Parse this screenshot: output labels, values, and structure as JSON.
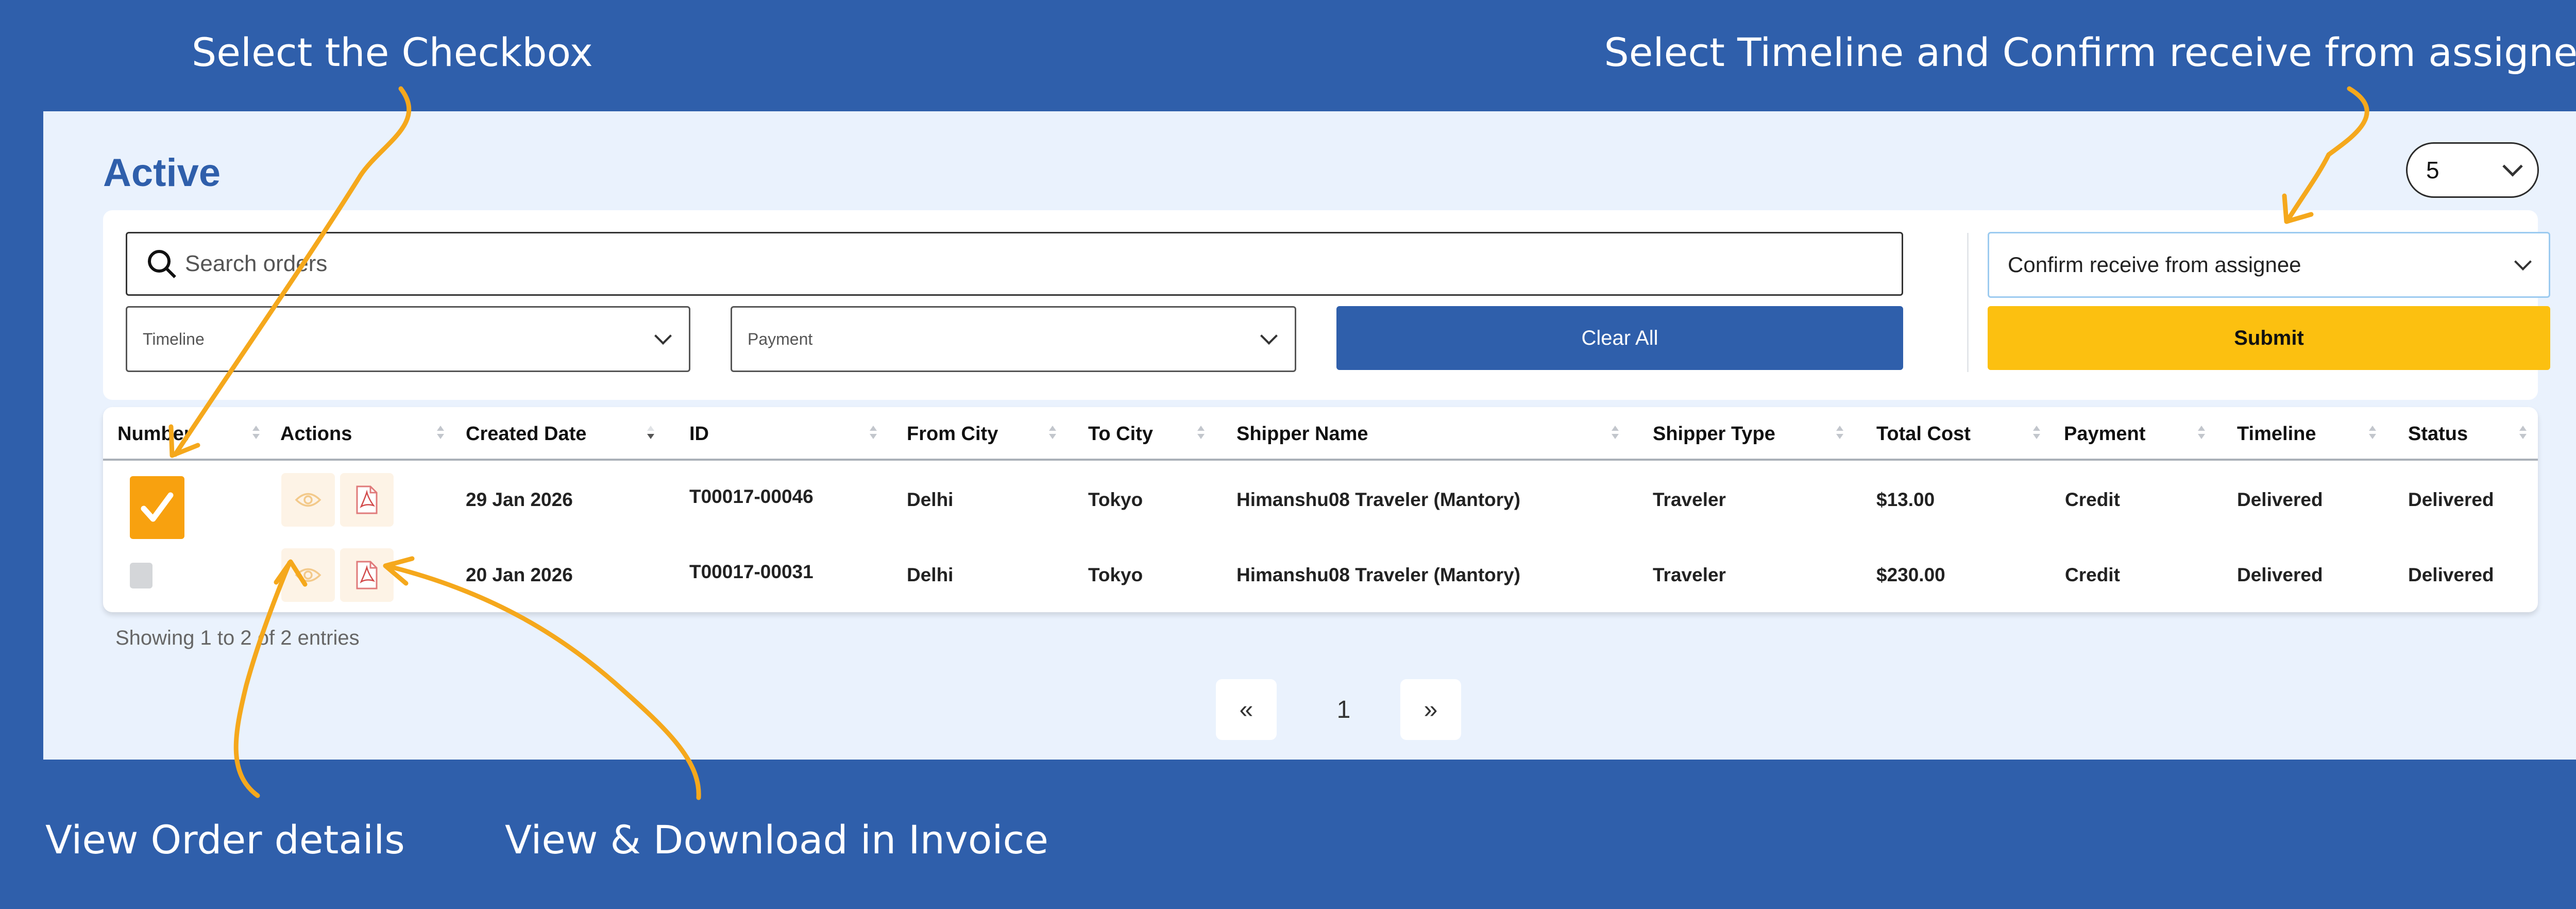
{
  "callouts": {
    "checkbox": "Select the Checkbox",
    "timeline": "Select Timeline and Confirm receive from assignee",
    "view_details": "View Order details",
    "invoice": "View & Download in Invoice"
  },
  "section_title": "Active",
  "page_size": "5",
  "filters": {
    "search_placeholder": "Search orders",
    "timeline_placeholder": "Timeline",
    "payment_placeholder": "Payment",
    "clear_all": "Clear All",
    "action_selected": "Confirm receive from assignee",
    "submit": "Submit"
  },
  "table": {
    "headers": [
      "Number",
      "Actions",
      "Created Date",
      "ID",
      "From City",
      "To City",
      "Shipper Name",
      "Shipper Type",
      "Total Cost",
      "Payment",
      "Timeline",
      "Status"
    ],
    "rows": [
      {
        "checked": true,
        "created": "29 Jan 2026",
        "id": "T00017-00046",
        "from": "Delhi",
        "to": "Tokyo",
        "shipper": "Himanshu08 Traveler (Mantory)",
        "shipper_type": "Traveler",
        "cost": "$13.00",
        "payment": "Credit",
        "timeline": "Delivered",
        "status": "Delivered"
      },
      {
        "checked": false,
        "created": "20 Jan 2026",
        "id": "T00017-00031",
        "from": "Delhi",
        "to": "Tokyo",
        "shipper": "Himanshu08 Traveler (Mantory)",
        "shipper_type": "Traveler",
        "cost": "$230.00",
        "payment": "Credit",
        "timeline": "Delivered",
        "status": "Delivered"
      }
    ]
  },
  "entries_info": "Showing 1 to 2 of 2 entries",
  "pagination": {
    "prev": "«",
    "current": "1",
    "next": "»"
  },
  "colors": {
    "background": "#2f5fab",
    "panel": "#eaf2fd",
    "accent_yellow": "#fcc010",
    "annotation_arrow": "#f5a81c",
    "checkbox": "#f8a10f"
  },
  "icons": [
    "search-icon",
    "chevron-down-icon",
    "eye-icon",
    "pdf-icon",
    "checkmark-icon",
    "sort-icon"
  ]
}
